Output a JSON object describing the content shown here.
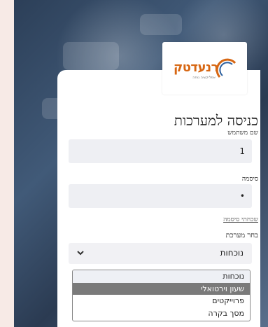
{
  "brand": {
    "logo_text": "רנעדטק",
    "logo_subtext": "אפליקציה נוחה"
  },
  "login": {
    "title": "כניסה למערכות",
    "username_label": "שם משתמש",
    "username_value": "1",
    "password_label": "סיסמה",
    "password_value": "•",
    "forgot_link": "שכחתי סיסמה",
    "system_label": "בחר מערכת",
    "selected_system": "נוכחות"
  },
  "system_options": [
    {
      "label": "נוכחות"
    },
    {
      "label": "שעון וירטואלי"
    },
    {
      "label": "פרוייקטים"
    },
    {
      "label": "מסך בקרה"
    }
  ],
  "colors": {
    "brand_orange": "#d76713",
    "highlight_option": "#7a7a7a",
    "field_bg": "#eeeff3"
  }
}
